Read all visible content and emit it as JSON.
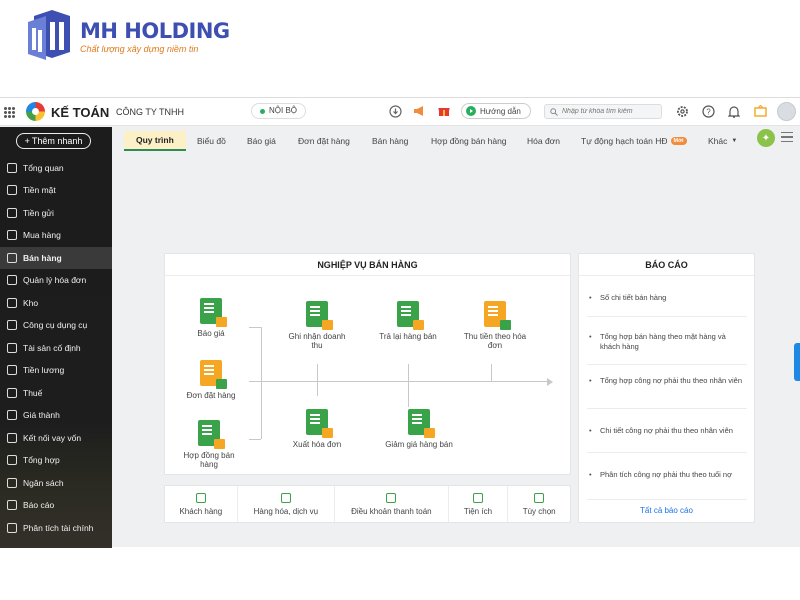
{
  "brand": {
    "title": "MH HOLDING",
    "tagline": "Chất lượng xây dựng niềm tin",
    "colors": {
      "primary": "#3d4fb0",
      "accent": "#e07a1d"
    }
  },
  "topbar": {
    "app_name": "KẾ TOÁN",
    "company": "CÔNG TY TNHH",
    "scope": "NỘI BỘ",
    "guide_label": "Hướng dẫn",
    "search_placeholder": "Nhập từ khóa tìm kiếm",
    "icons": [
      "apps-grid-icon",
      "download-icon",
      "megaphone-icon",
      "gift-icon",
      "settings-icon",
      "help-icon",
      "bell-icon",
      "inbox-icon",
      "avatar"
    ]
  },
  "sidebar": {
    "new_button": "Thêm nhanh",
    "items": [
      {
        "label": "Tổng quan",
        "icon": "dashboard-icon"
      },
      {
        "label": "Tiền mặt",
        "icon": "cash-icon"
      },
      {
        "label": "Tiền gửi",
        "icon": "bank-icon"
      },
      {
        "label": "Mua hàng",
        "icon": "purchase-icon"
      },
      {
        "label": "Bán hàng",
        "icon": "cart-icon",
        "active": true
      },
      {
        "label": "Quản lý hóa đơn",
        "icon": "invoice-icon"
      },
      {
        "label": "Kho",
        "icon": "warehouse-icon"
      },
      {
        "label": "Công cụ dụng cụ",
        "icon": "tools-icon"
      },
      {
        "label": "Tài sản cố định",
        "icon": "asset-icon"
      },
      {
        "label": "Tiền lương",
        "icon": "salary-icon"
      },
      {
        "label": "Thuế",
        "icon": "tax-icon"
      },
      {
        "label": "Giá thành",
        "icon": "price-tag-icon"
      },
      {
        "label": "Kết nối vay vốn",
        "icon": "loan-icon"
      },
      {
        "label": "Tổng hợp",
        "icon": "summary-icon"
      },
      {
        "label": "Ngân sách",
        "icon": "budget-icon"
      },
      {
        "label": "Báo cáo",
        "icon": "report-icon"
      },
      {
        "label": "Phân tích tài chính",
        "icon": "analytics-icon"
      }
    ]
  },
  "tabs": {
    "items": [
      "Quy trình",
      "Biểu đồ",
      "Báo giá",
      "Đơn đặt hàng",
      "Bán hàng",
      "Hợp đồng bán hàng",
      "Hóa đơn",
      "Tự động hạch toán HĐ",
      "Khác"
    ],
    "new_badge": "Mới"
  },
  "process": {
    "title": "NGHIỆP VỤ BÁN HÀNG",
    "nodes": [
      "Báo giá",
      "Đơn đặt hàng",
      "Hợp đồng bán hàng",
      "Ghi nhận doanh thu",
      "Xuất hóa đơn",
      "Trả lại hàng bán",
      "Giảm giá hàng bán",
      "Thu tiền theo hóa đơn"
    ]
  },
  "reports": {
    "title": "BÁO CÁO",
    "items": [
      "Sổ chi tiết bán hàng",
      "Tổng hợp bán hàng theo mặt hàng và khách hàng",
      "Tổng hợp công nợ phải thu theo nhân viên",
      "Chi tiết công nợ phải thu theo nhân viên",
      "Phân tích công nợ phải thu theo tuổi nợ"
    ],
    "all_link": "Tất cả báo cáo"
  },
  "utilities": [
    "Khách hàng",
    "Hàng hóa, dịch vụ",
    "Điều khoản thanh toán",
    "Tiện ích",
    "Tùy chọn"
  ]
}
